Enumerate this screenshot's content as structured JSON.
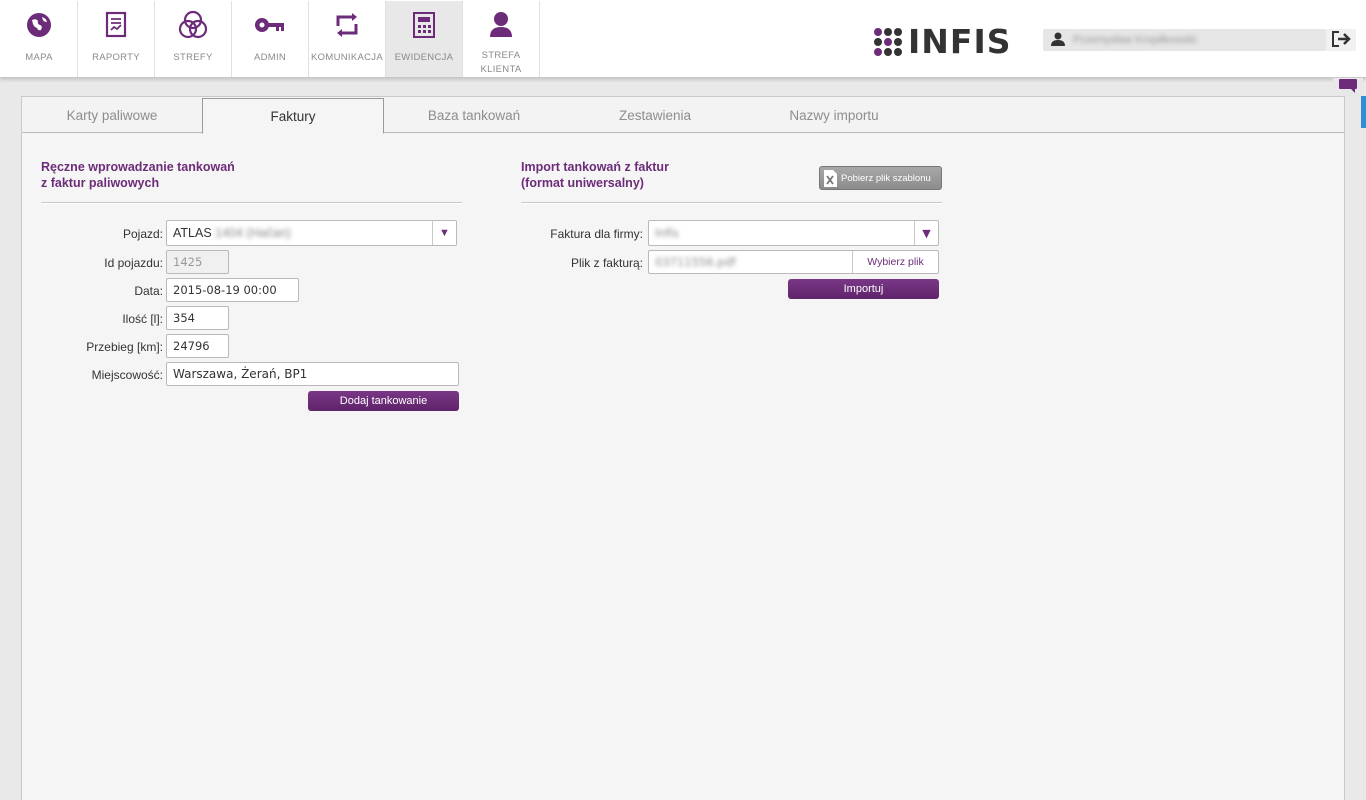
{
  "nav": {
    "items": [
      {
        "label": "MAPA",
        "icon": "globe-icon"
      },
      {
        "label": "RAPORTY",
        "icon": "report-icon"
      },
      {
        "label": "STREFY",
        "icon": "zones-icon"
      },
      {
        "label": "ADMIN",
        "icon": "key-icon"
      },
      {
        "label": "KOMUNIKACJA",
        "icon": "communication-icon"
      },
      {
        "label": "EWIDENCJA",
        "icon": "calculator-icon"
      },
      {
        "label": "STREFA",
        "label2": "KLIENTA",
        "icon": "user-icon"
      }
    ],
    "active": "EWIDENCJA"
  },
  "brand": {
    "name": "INFIS",
    "accent": "#6d2c79"
  },
  "user": {
    "name": "Przemysław Kropiłkowski"
  },
  "tabs": [
    "Karty paliwowe",
    "Faktury",
    "Baza tankowań",
    "Zestawienia",
    "Nazwy importu"
  ],
  "active_tab": "Faktury",
  "manual": {
    "title_line1": "Ręczne wprowadzanie tankowań",
    "title_line2": "z faktur paliwowych",
    "vehicle_label": "Pojazd:",
    "vehicle_value": "ATLAS",
    "vehicle_value_hidden": "1404 (Hačan)",
    "vehicle_id_label": "Id pojazdu:",
    "vehicle_id_value": "1425",
    "date_label": "Data:",
    "date_value": "2015-08-19 00:00",
    "qty_label": "Ilość [l]:",
    "qty_value": "354",
    "mileage_label": "Przebieg [km]:",
    "mileage_value": "24796",
    "place_label": "Miejscowość:",
    "place_value": "Warszawa, Żerań, BP1",
    "add_button": "Dodaj tankowanie"
  },
  "import": {
    "title_line1": "Import tankowań z faktur",
    "title_line2": "(format uniwersalny)",
    "template_button": "Pobierz plik szablonu",
    "company_label": "Faktura dla firmy:",
    "company_value": "Infis",
    "file_label": "Plik z fakturą:",
    "file_value": "03711556.pdf",
    "choose_file_button": "Wybierz plik",
    "import_button": "Importuj"
  }
}
